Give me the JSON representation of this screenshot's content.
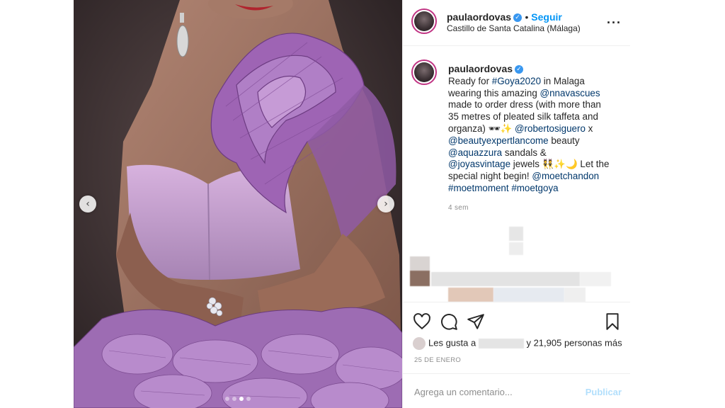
{
  "post": {
    "username": "paulaordovas",
    "follow_label": "Seguir",
    "location": "Castillo de Santa Catalina (Málaga)",
    "more_icon": "ellipsis-icon",
    "caption_parts": {
      "p1": "Ready for ",
      "t1": "#Goya2020",
      "p2": " in Malaga wearing this amazing ",
      "t2": "@nnavascues",
      "p3": " made to order dress (with more than 35 metres of pleated silk taffeta and organza) 🕶✨ ",
      "t3": "@robertosiguero",
      "p4": " x ",
      "t4": "@beautyexpertlancome",
      "p5": " beauty ",
      "t5": "@aquazzura",
      "p6": " sandals & ",
      "t6": "@joyasvintage",
      "p7": " jewels 👯✨🌙 Let the special night begin! ",
      "t7": "@moetchandon",
      "p8": " ",
      "t8": "#moetmoment",
      "p9": " ",
      "t9": "#moetgoya"
    },
    "caption_age": "4 sem",
    "likes_prefix": "Les gusta a",
    "likes_suffix": "y 21,905 personas más",
    "date": "25 DE ENERO",
    "comment_placeholder": "Agrega un comentario...",
    "publish_label": "Publicar"
  },
  "carousel": {
    "prev_icon": "chevron-left-icon",
    "next_icon": "chevron-right-icon",
    "dots": 4,
    "active_dot": 3
  },
  "colors": {
    "link": "#00376b",
    "follow": "#0095f6",
    "dress": "#b07fc6",
    "muted": "#8e8e8e"
  }
}
